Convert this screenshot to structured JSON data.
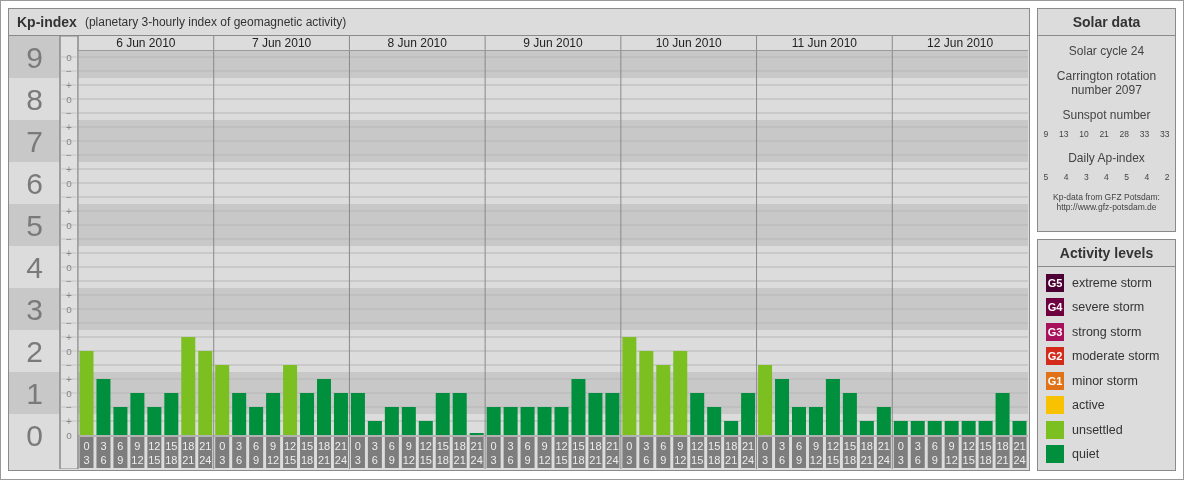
{
  "main_panel": {
    "title": "Kp-index",
    "subtitle": "(planetary 3-hourly index of geomagnetic activity)",
    "chart_data": {
      "type": "bar",
      "grid": true,
      "ylim": [
        0,
        9.17
      ],
      "yticks": [
        {
          "value": 9,
          "label": "9"
        },
        {
          "value": 8,
          "label": "8"
        },
        {
          "value": 7,
          "label": "7"
        },
        {
          "value": 6,
          "label": "6"
        },
        {
          "value": 5,
          "label": "5"
        },
        {
          "value": 4,
          "label": "4"
        },
        {
          "value": 3,
          "label": "3"
        },
        {
          "value": 2,
          "label": "2"
        },
        {
          "value": 1,
          "label": "1"
        },
        {
          "value": 0,
          "label": "0"
        }
      ],
      "series": [
        {
          "color": "#008f3c",
          "values": [
            null,
            1.33,
            0.67,
            1,
            0.67,
            1,
            null,
            null,
            null,
            1,
            0.67,
            1,
            null,
            1,
            1.33,
            1,
            1,
            0.33,
            0.67,
            0.67,
            0.33,
            1,
            1,
            0,
            0.67,
            0.67,
            0.67,
            0.67,
            0.67,
            1.33,
            1,
            1,
            null,
            null,
            null,
            null,
            1,
            0.67,
            0.33,
            1,
            null,
            1.33,
            0.67,
            0.67,
            1.33,
            1,
            0.33,
            0.67,
            0.33,
            0.33,
            0.33,
            0.33,
            0.33,
            0.33,
            1,
            0.33
          ]
        },
        {
          "color": "#7bbf20",
          "values": [
            2,
            null,
            null,
            null,
            null,
            null,
            2.33,
            2,
            1.67,
            null,
            null,
            null,
            1.67,
            null,
            null,
            null,
            null,
            null,
            null,
            null,
            null,
            null,
            null,
            null,
            null,
            null,
            null,
            null,
            null,
            null,
            null,
            null,
            2.33,
            2,
            1.67,
            2,
            null,
            null,
            null,
            null,
            1.67,
            null,
            null,
            null,
            null,
            null,
            null,
            null,
            null,
            null,
            null,
            null,
            null,
            null,
            null,
            null
          ]
        }
      ]
    },
    "minor_tick_labels": [
      "o",
      "−",
      "+",
      "o",
      "−",
      "+",
      "o",
      "−",
      "+",
      "o",
      "−",
      "+",
      "o",
      "−",
      "+",
      "o",
      "−",
      "+",
      "o",
      "−",
      "+",
      "o",
      "−",
      "+",
      "o",
      "−",
      "+",
      "o"
    ],
    "groups": [
      {
        "label": "6 Jun 2010",
        "bins": [
          {
            "from": "0",
            "to": "3"
          },
          {
            "from": "3",
            "to": "6"
          },
          {
            "from": "6",
            "to": "9"
          },
          {
            "from": "9",
            "to": "12"
          },
          {
            "from": "12",
            "to": "15"
          },
          {
            "from": "15",
            "to": "18"
          },
          {
            "from": "18",
            "to": "21"
          },
          {
            "from": "21",
            "to": "24"
          }
        ]
      },
      {
        "label": "7 Jun 2010",
        "bins": [
          {
            "from": "0",
            "to": "3"
          },
          {
            "from": "3",
            "to": "6"
          },
          {
            "from": "6",
            "to": "9"
          },
          {
            "from": "9",
            "to": "12"
          },
          {
            "from": "12",
            "to": "15"
          },
          {
            "from": "15",
            "to": "18"
          },
          {
            "from": "18",
            "to": "21"
          },
          {
            "from": "21",
            "to": "24"
          }
        ]
      },
      {
        "label": "8 Jun 2010",
        "bins": [
          {
            "from": "0",
            "to": "3"
          },
          {
            "from": "3",
            "to": "6"
          },
          {
            "from": "6",
            "to": "9"
          },
          {
            "from": "9",
            "to": "12"
          },
          {
            "from": "12",
            "to": "15"
          },
          {
            "from": "15",
            "to": "18"
          },
          {
            "from": "18",
            "to": "21"
          },
          {
            "from": "21",
            "to": "24"
          }
        ]
      },
      {
        "label": "9 Jun 2010",
        "bins": [
          {
            "from": "0",
            "to": "3"
          },
          {
            "from": "3",
            "to": "6"
          },
          {
            "from": "6",
            "to": "9"
          },
          {
            "from": "9",
            "to": "12"
          },
          {
            "from": "12",
            "to": "15"
          },
          {
            "from": "15",
            "to": "18"
          },
          {
            "from": "18",
            "to": "21"
          },
          {
            "from": "21",
            "to": "24"
          }
        ]
      },
      {
        "label": "10 Jun 2010",
        "bins": [
          {
            "from": "0",
            "to": "3"
          },
          {
            "from": "3",
            "to": "6"
          },
          {
            "from": "6",
            "to": "9"
          },
          {
            "from": "9",
            "to": "12"
          },
          {
            "from": "12",
            "to": "15"
          },
          {
            "from": "15",
            "to": "18"
          },
          {
            "from": "18",
            "to": "21"
          },
          {
            "from": "21",
            "to": "24"
          }
        ]
      },
      {
        "label": "11 Jun 2010",
        "bins": [
          {
            "from": "0",
            "to": "3"
          },
          {
            "from": "3",
            "to": "6"
          },
          {
            "from": "6",
            "to": "9"
          },
          {
            "from": "9",
            "to": "12"
          },
          {
            "from": "12",
            "to": "15"
          },
          {
            "from": "15",
            "to": "18"
          },
          {
            "from": "18",
            "to": "21"
          },
          {
            "from": "21",
            "to": "24"
          }
        ]
      },
      {
        "label": "12 Jun 2010",
        "bins": [
          {
            "from": "0",
            "to": "3"
          },
          {
            "from": "3",
            "to": "6"
          },
          {
            "from": "6",
            "to": "9"
          },
          {
            "from": "9",
            "to": "12"
          },
          {
            "from": "12",
            "to": "15"
          },
          {
            "from": "15",
            "to": "18"
          },
          {
            "from": "18",
            "to": "21"
          },
          {
            "from": "21",
            "to": "24"
          }
        ]
      }
    ]
  },
  "solar_data": {
    "title": "Solar data",
    "cycle": "Solar cycle 24",
    "rotation": "Carrington rotation number 2097",
    "sunspot_heading": "Sunspot number",
    "sunspots": [
      "9",
      "13",
      "10",
      "21",
      "28",
      "33",
      "33"
    ],
    "ap_heading": "Daily Ap-index",
    "ap_values": [
      "5",
      "4",
      "3",
      "4",
      "5",
      "4",
      "2"
    ],
    "source": "Kp-data from GFZ Potsdam:",
    "source_url": "http://www.gfz-potsdam.de"
  },
  "activity_levels": {
    "title": "Activity levels",
    "items": [
      {
        "badge": "G5",
        "label": "extreme storm",
        "color": "#4d0033"
      },
      {
        "badge": "G4",
        "label": "severe storm",
        "color": "#6e0040"
      },
      {
        "badge": "G3",
        "label": "strong storm",
        "color": "#a8105c"
      },
      {
        "badge": "G2",
        "label": "moderate storm",
        "color": "#d42a1c"
      },
      {
        "badge": "G1",
        "label": "minor storm",
        "color": "#e27218"
      },
      {
        "label": "active",
        "color": "#f8c200"
      },
      {
        "label": "unsettled",
        "color": "#7bbf20"
      },
      {
        "label": "quiet",
        "color": "#008f3c"
      }
    ]
  }
}
